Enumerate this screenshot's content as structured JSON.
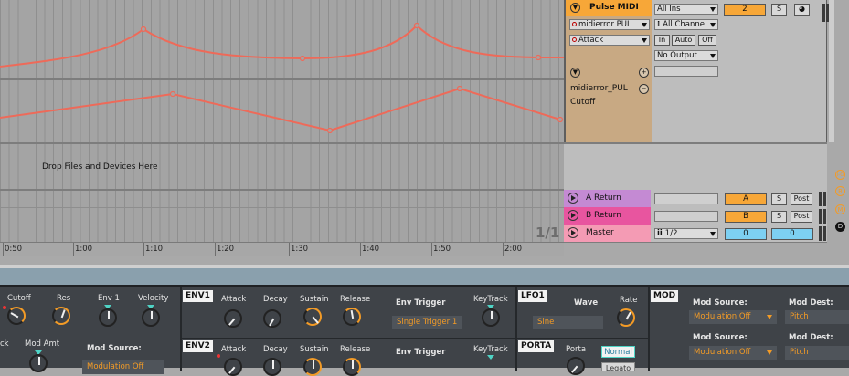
{
  "arrangement": {
    "drop_text": "Drop Files and Devices Here",
    "page_counter": "1/1",
    "ruler_labels": [
      "0:50",
      "1:00",
      "1:10",
      "1:20",
      "1:30",
      "1:40",
      "1:50",
      "2:00"
    ]
  },
  "track": {
    "name": "Pulse MIDI",
    "midi_from": "midierror PUL",
    "midi_control": "Attack",
    "device_label": "midierror_PUL",
    "parameter_label": "Cutoff"
  },
  "io": {
    "input_type": "All Ins",
    "input_channel": "All Channe",
    "monitor_in": "In",
    "monitor_auto": "Auto",
    "monitor_off": "Off",
    "output": "No Output"
  },
  "mixer": {
    "track_number": "2",
    "solo": "S"
  },
  "returns": [
    {
      "name": "A Return",
      "color": "#c48ad3",
      "send": "A",
      "solo": "S",
      "post": "Post"
    },
    {
      "name": "B Return",
      "color": "#e8559f",
      "send": "B",
      "solo": "S",
      "post": "Post"
    }
  ],
  "master": {
    "name": "Master",
    "color": "#f49bb4",
    "output": "1/2",
    "value_1": "0",
    "value_2": "0"
  },
  "side_buttons": [
    "I-O",
    "R",
    "M",
    "D"
  ],
  "device": {
    "filter": {
      "cutoff": "Cutoff",
      "res": "Res",
      "env1": "Env 1",
      "velocity": "Velocity",
      "partial_ck": "ck",
      "mod_amt": "Mod Amt",
      "mod_source": "Mod Source:",
      "mod_source_value": "Modulation Off"
    },
    "env1": {
      "tag": "ENV1",
      "attack": "Attack",
      "decay": "Decay",
      "sustain": "Sustain",
      "release": "Release",
      "trigger_label": "Env Trigger",
      "trigger_value": "Single Trigger 1",
      "keytrack": "KeyTrack"
    },
    "env2": {
      "tag": "ENV2",
      "attack": "Attack",
      "decay": "Decay",
      "sustain": "Sustain",
      "release": "Release",
      "trigger_label": "Env Trigger",
      "keytrack": "KeyTrack"
    },
    "lfo1": {
      "tag": "LFO1",
      "wave": "Wave",
      "rate": "Rate",
      "wave_value": "Sine"
    },
    "porta": {
      "tag": "PORTA",
      "porta": "Porta",
      "mode": "Normal",
      "partial_value": "Legato"
    },
    "mod": {
      "tag": "MOD",
      "source_label_1": "Mod Source:",
      "source_value_1": "Modulation Off",
      "dest_label_1": "Mod Dest:",
      "dest_value_1": "Pitch",
      "source_label_2": "Mod Source:",
      "source_value_2": "Modulation Off",
      "dest_label_2": "Mod Dest:",
      "dest_value_2": "Pitch"
    }
  },
  "colors": {
    "automation": "#ee6a59",
    "accent": "#f7a738",
    "track_header": "#c8a983"
  }
}
